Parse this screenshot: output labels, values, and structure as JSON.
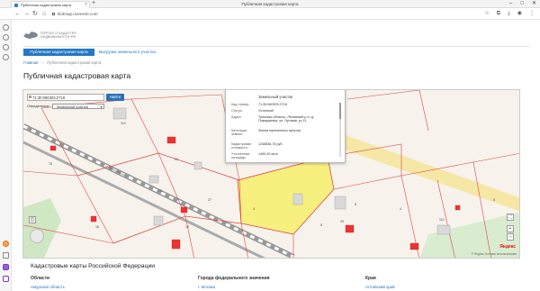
{
  "browser": {
    "tab_title": "Публичная кадастровая карта",
    "window_title": "Публичная кадастровая карта",
    "new_tab": "+",
    "url": "kb3map.rosreestr.com",
    "controls": [
      "–",
      "□",
      "✕"
    ]
  },
  "header": {
    "logo_text": "ПОРТАЛ О КАДАСТРЕ НЕДВИЖИМОСТИ РФ"
  },
  "nav": {
    "primary_button": "Публичная кадастровая карта",
    "export_link": "Выгрузка земельного участка"
  },
  "breadcrumb": [
    "Главная",
    "›",
    "Публичная кадастровая карта"
  ],
  "page_title": "Публичная кадастровая карта",
  "map": {
    "search_value": "71:30:060303:2718",
    "find_button": "Найти",
    "filter_label": "Определение:",
    "filter_value": "Земельный участок",
    "parcel_labels": [
      "78",
      "119",
      "71",
      "31",
      "16",
      "27",
      "18",
      "4",
      "5",
      "29",
      "8",
      "4",
      "110",
      "8"
    ],
    "road_label": "ул. Демидовская",
    "zoom_in": "+",
    "zoom_out": "–",
    "fullscreen": "⛶",
    "yandex_logo": "Яндекс",
    "footer_text": "© Яндекс Условия использования",
    "popup": {
      "title": "Земельный участок",
      "rows": [
        {
          "k": "Кад. номер:",
          "v": "71:30:060303:2718"
        },
        {
          "k": "Статус:",
          "v": "Учтенный"
        },
        {
          "k": "Адрес:",
          "v": "Тульская область, Ленинский р-н, д. Пожидаевка, ул. Луговая, уч 11"
        },
        {
          "k": "Категория земель:",
          "v": "Земли населенных пунктов"
        },
        {
          "k": "Кадастровая стоимость:",
          "v": "1248836,78 руб."
        },
        {
          "k": "Уточненная площадь:",
          "v": "1400,00 кв.м"
        }
      ]
    }
  },
  "regions": {
    "title": "Кадастровые карты Российской Федерации",
    "columns": [
      {
        "heading": "Области",
        "first_link": "Амурская область"
      },
      {
        "heading": "Города федерального значения",
        "first_link": "г. Москва"
      },
      {
        "heading": "Края",
        "first_link": "Алтайский край"
      }
    ]
  }
}
